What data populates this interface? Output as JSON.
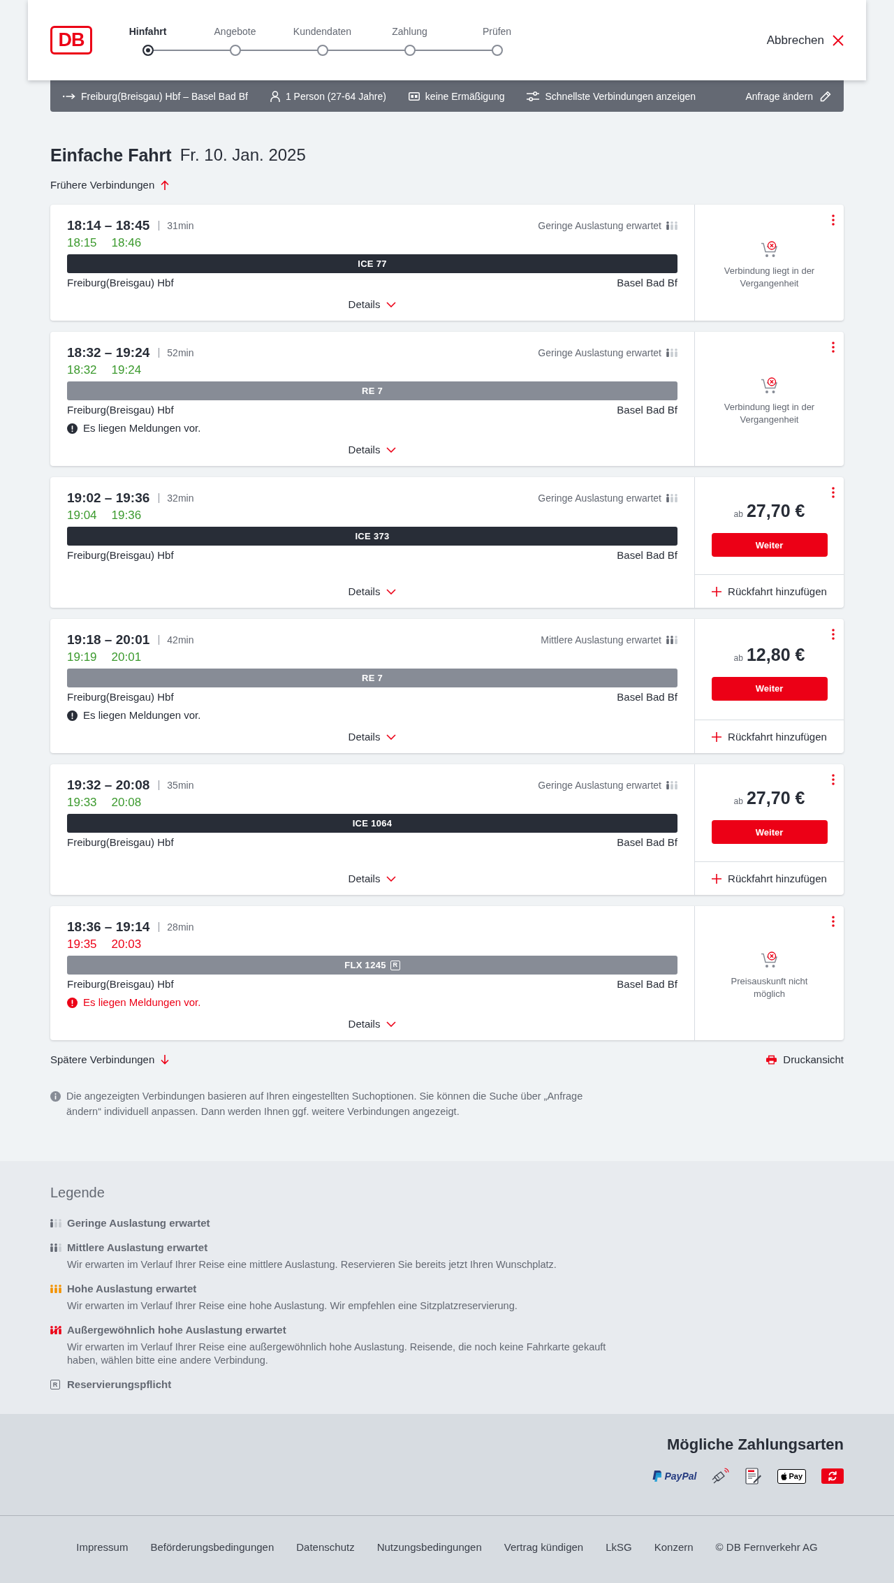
{
  "header": {
    "logo": "DB",
    "steps": [
      {
        "label": "Hinfahrt",
        "selected": true
      },
      {
        "label": "Angebote",
        "selected": false
      },
      {
        "label": "Kundendaten",
        "selected": false
      },
      {
        "label": "Zahlung",
        "selected": false
      },
      {
        "label": "Prüfen",
        "selected": false
      }
    ],
    "cancel": "Abbrechen"
  },
  "search_summary": {
    "route": "Freiburg(Breisgau) Hbf – Basel Bad Bf",
    "passengers": "1 Person (27-64 Jahre)",
    "discount": "keine Ermäßigung",
    "search_option": "Schnellste Verbindungen anzeigen",
    "edit": "Anfrage ändern"
  },
  "title": {
    "trip_type": "Einfache Fahrt",
    "date": "Fr. 10. Jan. 2025"
  },
  "earlier_connections": "Frühere Verbindungen",
  "connections": [
    {
      "time_range": "18:14 – 18:45",
      "duration": "31min",
      "realtime": {
        "departure": "18:15",
        "arrival": "18:46",
        "delayed": false
      },
      "load": {
        "kind": "low",
        "text": "Geringe Auslastung erwartet"
      },
      "train": {
        "kind": "long_distance",
        "name": "ICE 77"
      },
      "from": "Freiburg(Breisgau) Hbf",
      "to": "Basel Bad Bf",
      "details": "Details",
      "offer": {
        "kind": "notice",
        "text": "Verbindung liegt in der Vergangenheit"
      }
    },
    {
      "time_range": "18:32 – 19:24",
      "duration": "52min",
      "realtime": {
        "departure": "18:32",
        "arrival": "19:24",
        "delayed": false
      },
      "load": {
        "kind": "low",
        "text": "Geringe Auslastung erwartet"
      },
      "train": {
        "kind": "regional",
        "name": "RE 7"
      },
      "from": "Freiburg(Breisgau) Hbf",
      "to": "Basel Bad Bf",
      "message": {
        "kind": "info",
        "text": "Es liegen Meldungen vor."
      },
      "details": "Details",
      "offer": {
        "kind": "notice",
        "text": "Verbindung liegt in der Vergangenheit"
      }
    },
    {
      "time_range": "19:02 – 19:36",
      "duration": "32min",
      "realtime": {
        "departure": "19:04",
        "arrival": "19:36",
        "delayed": false
      },
      "load": {
        "kind": "low",
        "text": "Geringe Auslastung erwartet"
      },
      "train": {
        "kind": "long_distance",
        "name": "ICE 373"
      },
      "from": "Freiburg(Breisgau) Hbf",
      "to": "Basel Bad Bf",
      "details": "Details",
      "offer": {
        "kind": "price",
        "prefix": "ab",
        "price": "27,70 €",
        "button": "Weiter",
        "return_trip": "Rückfahrt hinzufügen"
      }
    },
    {
      "time_range": "19:18 – 20:01",
      "duration": "42min",
      "realtime": {
        "departure": "19:19",
        "arrival": "20:01",
        "delayed": false
      },
      "load": {
        "kind": "medium",
        "text": "Mittlere Auslastung erwartet"
      },
      "train": {
        "kind": "regional",
        "name": "RE 7"
      },
      "from": "Freiburg(Breisgau) Hbf",
      "to": "Basel Bad Bf",
      "message": {
        "kind": "info",
        "text": "Es liegen Meldungen vor."
      },
      "details": "Details",
      "offer": {
        "kind": "price",
        "prefix": "ab",
        "price": "12,80 €",
        "button": "Weiter",
        "return_trip": "Rückfahrt hinzufügen"
      }
    },
    {
      "time_range": "19:32 – 20:08",
      "duration": "35min",
      "realtime": {
        "departure": "19:33",
        "arrival": "20:08",
        "delayed": false
      },
      "load": {
        "kind": "low",
        "text": "Geringe Auslastung erwartet"
      },
      "train": {
        "kind": "long_distance",
        "name": "ICE 1064"
      },
      "from": "Freiburg(Breisgau) Hbf",
      "to": "Basel Bad Bf",
      "details": "Details",
      "offer": {
        "kind": "price",
        "prefix": "ab",
        "price": "27,70 €",
        "button": "Weiter",
        "return_trip": "Rückfahrt hinzufügen"
      }
    },
    {
      "time_range": "18:36 – 19:14",
      "duration": "28min",
      "realtime": {
        "departure": "19:35",
        "arrival": "20:03",
        "delayed": true
      },
      "train": {
        "kind": "regional",
        "name": "FLX 1245",
        "reservation_badge": "R"
      },
      "from": "Freiburg(Breisgau) Hbf",
      "to": "Basel Bad Bf",
      "message": {
        "kind": "warning",
        "text": "Es liegen Meldungen vor."
      },
      "details": "Details",
      "offer": {
        "kind": "notice",
        "text": "Preisauskunft nicht möglich"
      }
    }
  ],
  "later_connections": "Spätere Verbindungen",
  "print_view": "Druckansicht",
  "info": "Die angezeigten Verbindungen basieren auf Ihren eingestellten Suchoptionen. Sie können die Suche über „Anfrage ändern“ individuell anpassen. Dann werden Ihnen ggf. weitere Verbindungen angezeigt.",
  "legend": {
    "title": "Legende",
    "items": [
      {
        "kind": "low",
        "title": "Geringe Auslastung erwartet"
      },
      {
        "kind": "medium",
        "title": "Mittlere Auslastung erwartet",
        "text": "Wir erwarten im Verlauf Ihrer Reise eine mittlere Auslastung. Reservieren Sie bereits jetzt Ihren Wunschplatz."
      },
      {
        "kind": "high",
        "title": "Hohe Auslastung erwartet",
        "text": "Wir erwarten im Verlauf Ihrer Reise eine hohe Auslastung. Wir empfehlen eine Sitzplatzreservierung."
      },
      {
        "kind": "exceptional",
        "title": "Außergewöhnlich hohe Auslastung erwartet",
        "text": "Wir erwarten im Verlauf Ihrer Reise eine außergewöhnlich hohe Auslastung. Reisende, die noch keine Fahrkarte gekauft haben, wählen bitte eine andere Verbindung."
      },
      {
        "kind": "reservation",
        "badge": "R",
        "title": "Reservierungspflicht"
      }
    ]
  },
  "payment": {
    "title": "Mögliche Zahlungsarten",
    "methods": [
      {
        "kind": "paypal",
        "label": "PayPal"
      },
      {
        "kind": "card"
      },
      {
        "kind": "sepa"
      },
      {
        "kind": "apple_pay",
        "label": "Pay"
      },
      {
        "kind": "bonus"
      }
    ]
  },
  "footer": {
    "links": [
      "Impressum",
      "Beförderungsbedingungen",
      "Datenschutz",
      "Nutzungsbedingungen",
      "Vertrag kündigen",
      "LkSG",
      "Konzern"
    ],
    "copyright": "© DB Fernverkehr AG"
  }
}
